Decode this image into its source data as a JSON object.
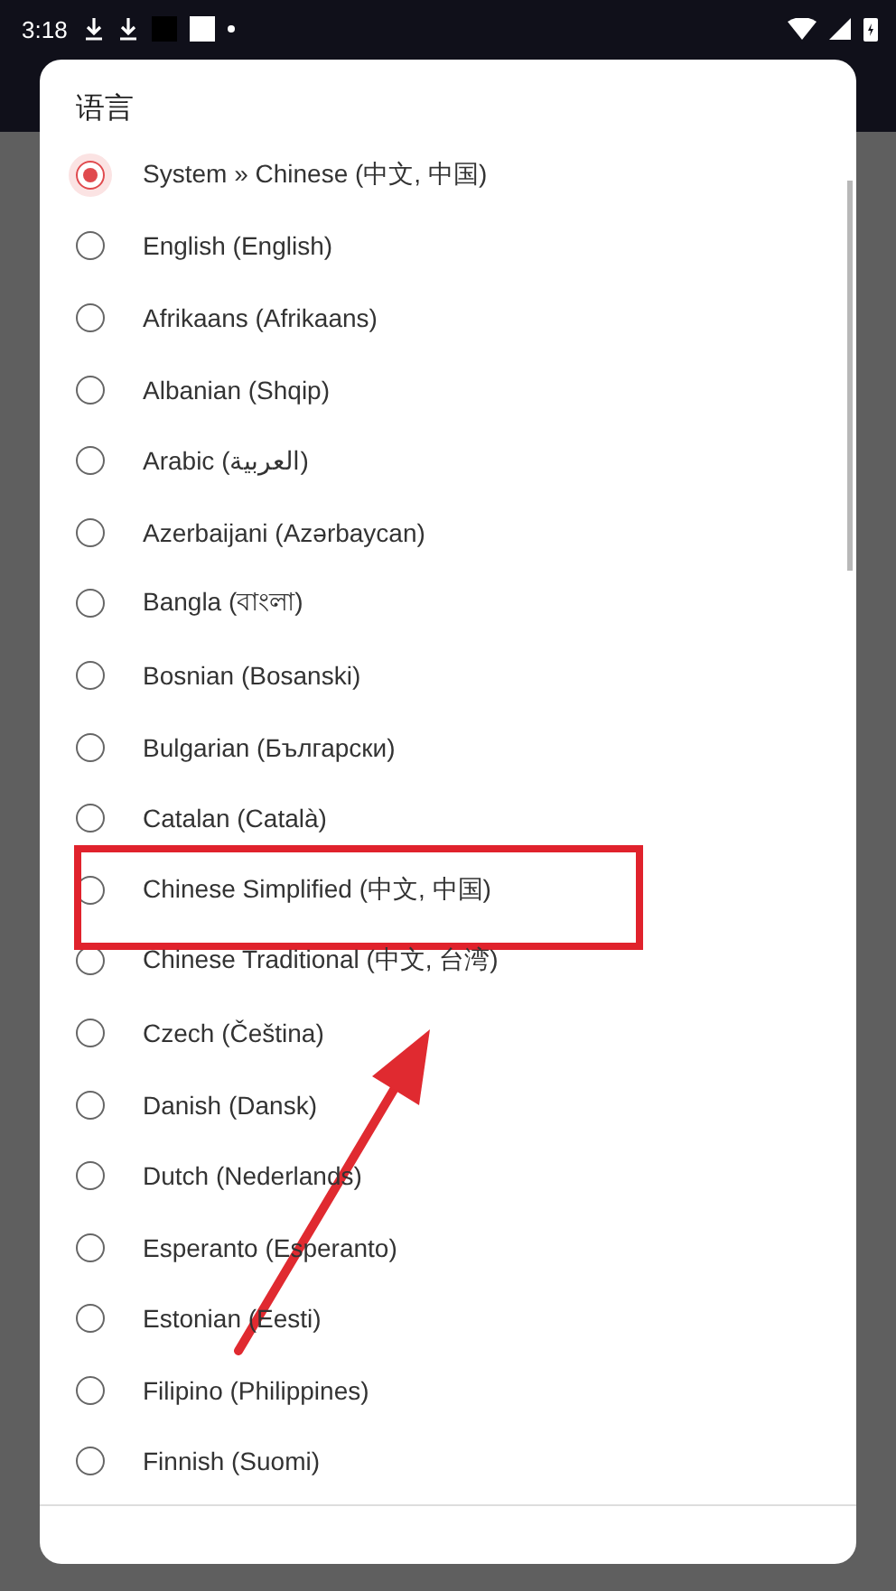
{
  "status_bar": {
    "time": "3:18"
  },
  "dialog": {
    "title": "语言",
    "options": [
      {
        "label": "System » Chinese (中文, 中国)",
        "selected": true,
        "highlighted": false
      },
      {
        "label": "English (English)",
        "selected": false,
        "highlighted": false
      },
      {
        "label": "Afrikaans (Afrikaans)",
        "selected": false,
        "highlighted": false
      },
      {
        "label": "Albanian (Shqip)",
        "selected": false,
        "highlighted": false
      },
      {
        "label": "Arabic (العربية)",
        "selected": false,
        "highlighted": false
      },
      {
        "label": "Azerbaijani (Azərbaycan)",
        "selected": false,
        "highlighted": false
      },
      {
        "label": "Bangla (বাংলা)",
        "selected": false,
        "highlighted": false
      },
      {
        "label": "Bosnian (Bosanski)",
        "selected": false,
        "highlighted": false
      },
      {
        "label": "Bulgarian (Български)",
        "selected": false,
        "highlighted": false
      },
      {
        "label": "Catalan (Català)",
        "selected": false,
        "highlighted": false
      },
      {
        "label": "Chinese Simplified (中文, 中国)",
        "selected": false,
        "highlighted": true
      },
      {
        "label": "Chinese Traditional (中文, 台湾)",
        "selected": false,
        "highlighted": false
      },
      {
        "label": "Czech (Čeština)",
        "selected": false,
        "highlighted": false
      },
      {
        "label": "Danish (Dansk)",
        "selected": false,
        "highlighted": false
      },
      {
        "label": "Dutch (Nederlands)",
        "selected": false,
        "highlighted": false
      },
      {
        "label": "Esperanto (Esperanto)",
        "selected": false,
        "highlighted": false
      },
      {
        "label": "Estonian (Eesti)",
        "selected": false,
        "highlighted": false
      },
      {
        "label": "Filipino (Philippines)",
        "selected": false,
        "highlighted": false
      },
      {
        "label": "Finnish (Suomi)",
        "selected": false,
        "highlighted": false
      }
    ]
  }
}
